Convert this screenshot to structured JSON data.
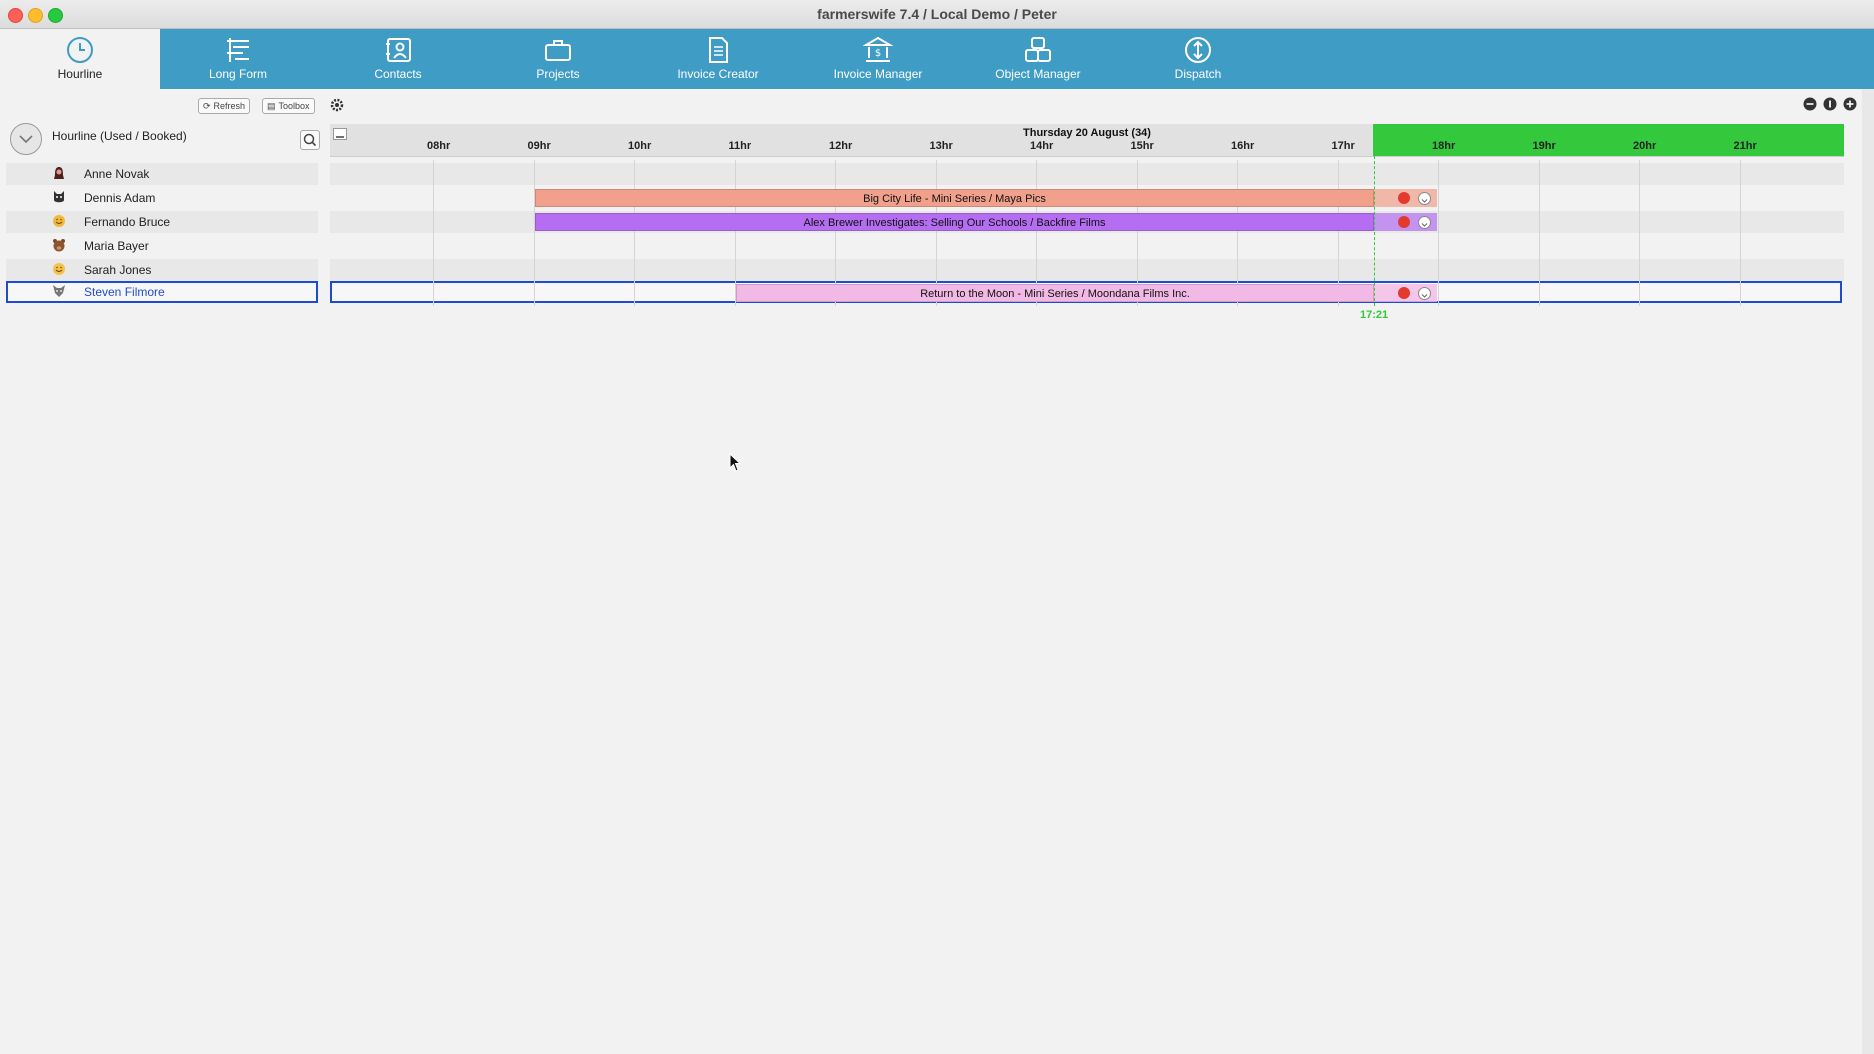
{
  "window": {
    "title": "farmerswife 7.4  / Local Demo / Peter"
  },
  "nav": {
    "tabs": [
      {
        "label": "Hourline",
        "icon": "clock-icon",
        "active": true
      },
      {
        "label": "Long Form",
        "icon": "gantt-icon"
      },
      {
        "label": "Contacts",
        "icon": "contact-card-icon"
      },
      {
        "label": "Projects",
        "icon": "briefcase-icon"
      },
      {
        "label": "Invoice Creator",
        "icon": "document-icon"
      },
      {
        "label": "Invoice Manager",
        "icon": "bank-icon"
      },
      {
        "label": "Object Manager",
        "icon": "cubes-icon"
      },
      {
        "label": "Dispatch",
        "icon": "dispatch-icon"
      }
    ]
  },
  "toolbar": {
    "refresh_label": "Refresh",
    "toolbox_label": "Toolbox"
  },
  "left_panel": {
    "title": "Hourline (Used / Booked)"
  },
  "resources": [
    {
      "name": "Anne Novak",
      "avatar": "woman-avatar-icon"
    },
    {
      "name": "Dennis Adam",
      "avatar": "cat-avatar-icon"
    },
    {
      "name": "Fernando Bruce",
      "avatar": "smiley-avatar-icon"
    },
    {
      "name": "Maria Bayer",
      "avatar": "bear-avatar-icon"
    },
    {
      "name": "Sarah Jones",
      "avatar": "smiley-avatar-icon"
    },
    {
      "name": "Steven Filmore",
      "avatar": "wolf-avatar-icon",
      "selected": true
    }
  ],
  "timeline": {
    "day_label": "Thursday 20 August (34)",
    "hours": [
      "08hr",
      "09hr",
      "10hr",
      "11hr",
      "12hr",
      "13hr",
      "14hr",
      "15hr",
      "16hr",
      "17hr",
      "18hr",
      "19hr",
      "20hr",
      "21hr"
    ],
    "now_label": "17:21",
    "colors": {
      "now": "#34c83d"
    }
  },
  "bookings": [
    {
      "label": "Big City Life - Mini Series / Maya Pics",
      "row": 1,
      "color": "#f1a08c"
    },
    {
      "label": "Alex Brewer Investigates: Selling Our Schools / Backfire Films",
      "row": 2,
      "color": "#b56df2"
    },
    {
      "label": "Return to the Moon - Mini Series / Moondana Films Inc.",
      "row": 5,
      "color": "#f2b9e6"
    }
  ]
}
